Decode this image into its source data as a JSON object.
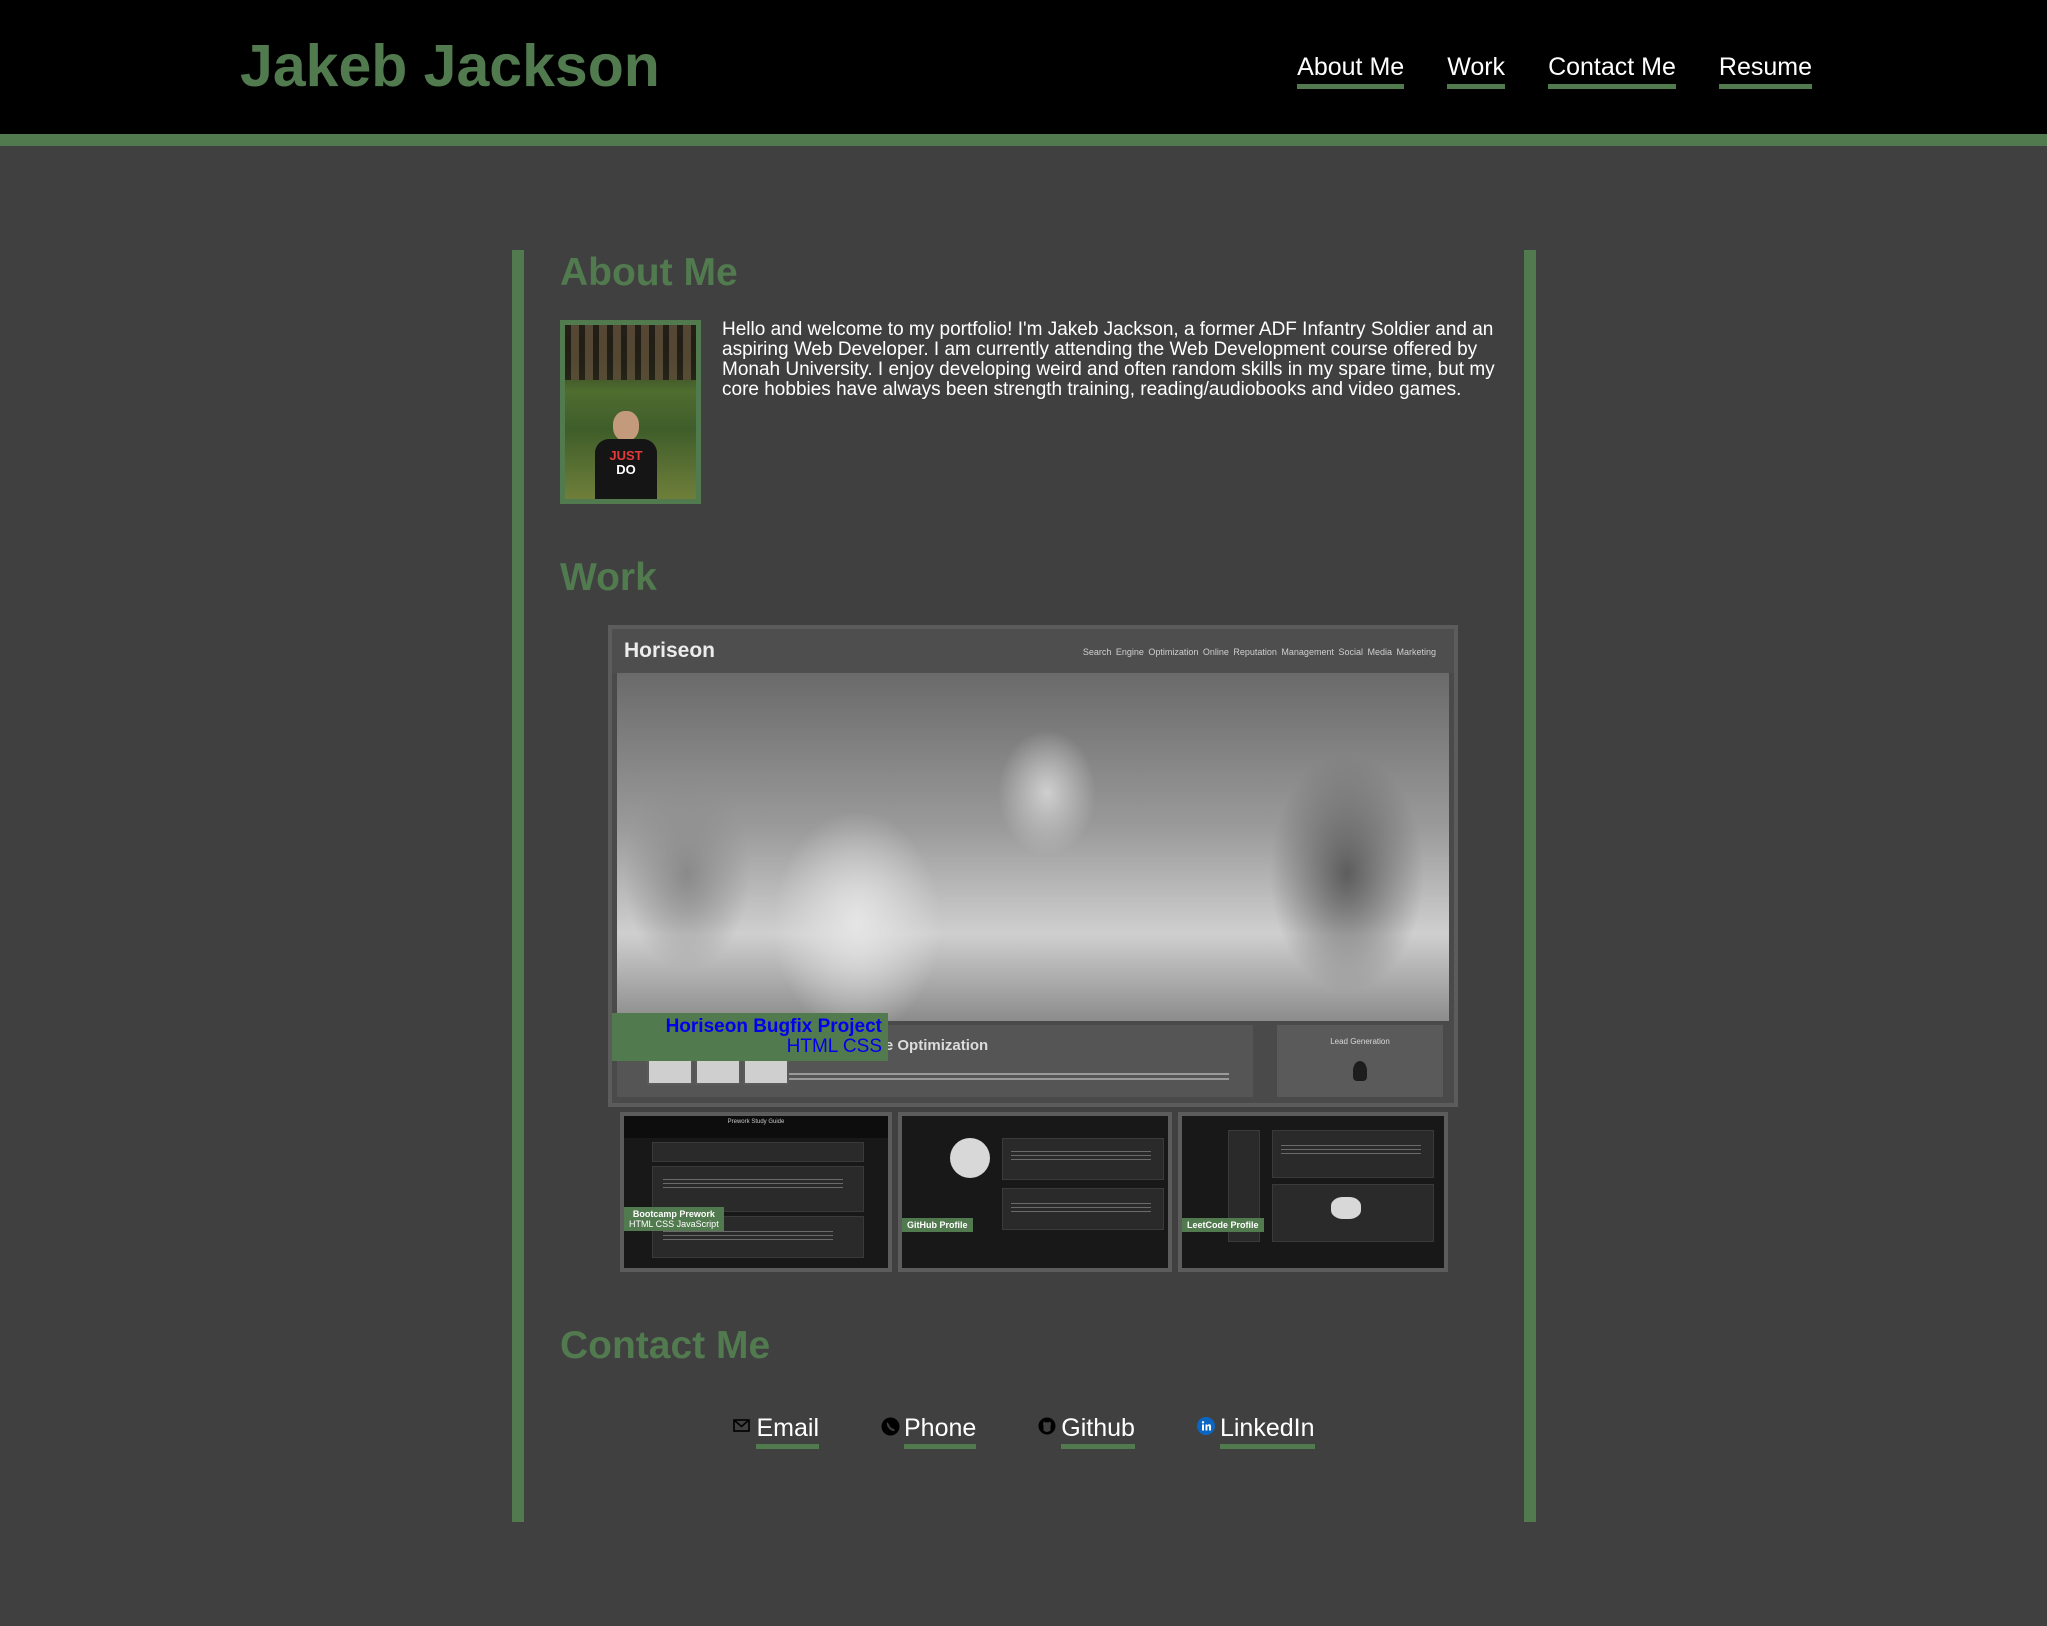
{
  "header": {
    "site_title": "Jakeb Jackson",
    "nav": [
      "About Me",
      "Work",
      "Contact Me",
      "Resume"
    ]
  },
  "about": {
    "heading": "About Me",
    "text": "Hello and welcome to my portfolio! I'm Jakeb Jackson, a former ADF Infantry Soldier and an aspiring Web Developer. I am currently attending the Web Development course offered by Monah University. I enjoy developing weird and often random skills in my spare time, but my core hobbies have always been strength training, reading/audiobooks and video games.",
    "photo_shirt_text": [
      "JUST",
      "DO"
    ]
  },
  "work": {
    "heading": "Work",
    "featured": {
      "title": "Horiseon Bugfix Project",
      "tech": "HTML CSS",
      "screenshot": {
        "logo": "Horiseon",
        "nav": "Search Engine Optimization   Online Reputation Management   Social Media Marketing",
        "content_title": "Search Engine Optimization",
        "side_title": "Lead Generation"
      }
    },
    "projects": [
      {
        "title": "Bootcamp Prework",
        "tech": "HTML CSS JavaScript",
        "screen_title": "Prework Study Guide"
      },
      {
        "title": "GitHub Profile",
        "tech": ""
      },
      {
        "title": "LeetCode Profile",
        "tech": ""
      }
    ]
  },
  "contact": {
    "heading": "Contact Me",
    "links": [
      {
        "label": "Email",
        "icon": "envelope-icon"
      },
      {
        "label": "Phone",
        "icon": "phone-icon"
      },
      {
        "label": "Github",
        "icon": "github-icon"
      },
      {
        "label": "LinkedIn",
        "icon": "linkedin-icon"
      }
    ]
  },
  "colors": {
    "accent": "#517a4f",
    "background": "#404040",
    "header": "#000000",
    "text": "#ffffff"
  }
}
